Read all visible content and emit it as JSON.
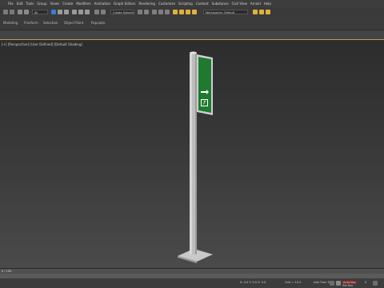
{
  "menu": {
    "items": [
      "File",
      "Edit",
      "Tools",
      "Group",
      "Views",
      "Create",
      "Modifiers",
      "Animation",
      "Graph Editors",
      "Rendering",
      "Customize",
      "Scripting",
      "Content",
      "Substance",
      "Civil View",
      "Arnold",
      "Help"
    ]
  },
  "toolbar": {
    "selection_filter": "All",
    "named_selection": "Create Selection Set",
    "workspace": "Workspaces: Default"
  },
  "ribbon": {
    "tabs": [
      "Modeling",
      "Freeform",
      "Selection",
      "Object Paint",
      "Populate"
    ]
  },
  "viewport": {
    "label": "[+] [Perspective] [User Defined] [Default Shading]",
    "background": "#333333",
    "active_border_color": "#b7a255"
  },
  "scene": {
    "object": "exit-sign-pole",
    "pole_color": "#bcbcbc",
    "sign_color": "#1f7a2f",
    "sign_symbol": "emergency-exit-arrow-right"
  },
  "timeline": {
    "frame": "0 / 100"
  },
  "status": {
    "coords": "X: 0.0  Y: 0.0  Z: 0.0",
    "grid": "Grid = 10.0",
    "add_time_tag": "Add Time Tag",
    "auto_key": "Auto Key",
    "set_key": "Set Key",
    "frame_value": "0"
  },
  "colors": {
    "ui_dark": "#3a3a3a",
    "accent_blue": "#3a7bd5",
    "warning_yellow": "#e0b23a"
  }
}
